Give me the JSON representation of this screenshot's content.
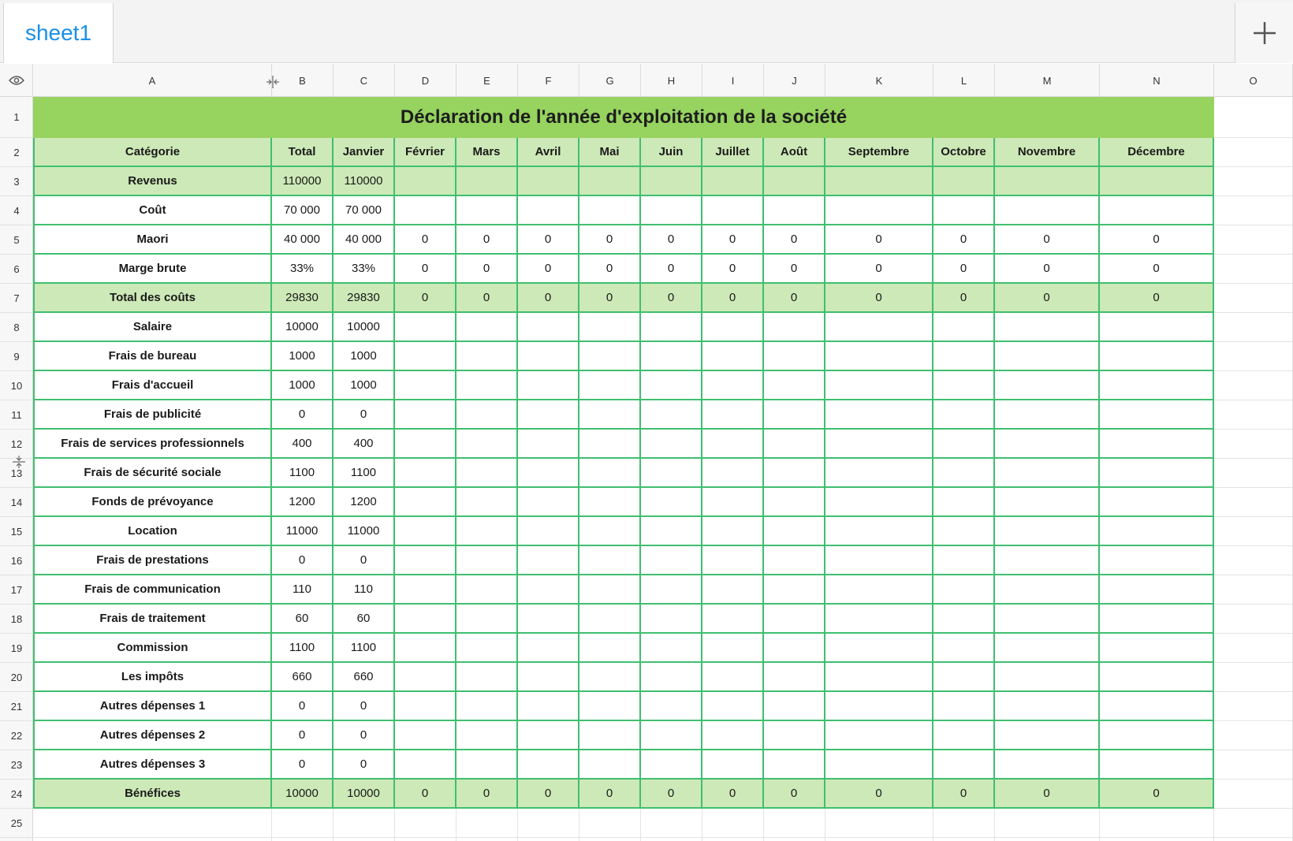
{
  "tabs": [
    {
      "label": "sheet1",
      "active": true
    }
  ],
  "columns": [
    "A",
    "B",
    "C",
    "D",
    "E",
    "F",
    "G",
    "H",
    "I",
    "J",
    "K",
    "L",
    "M",
    "N",
    "O"
  ],
  "title": "Déclaration de l'année d'exploitation de la société",
  "header_row": [
    "Catégorie",
    "Total",
    "Janvier",
    "Février",
    "Mars",
    "Avril",
    "Mai",
    "Juin",
    "Juillet",
    "Août",
    "Septembre",
    "Octobre",
    "Novembre",
    "Décembre"
  ],
  "rows": [
    {
      "n": 3,
      "style": "lg",
      "cells": [
        "Revenus",
        "110000",
        "110000",
        "",
        "",
        "",
        "",
        "",
        "",
        "",
        "",
        "",
        "",
        ""
      ]
    },
    {
      "n": 4,
      "style": "wh",
      "cells": [
        "Coût",
        "70 000",
        "70 000",
        "",
        "",
        "",
        "",
        "",
        "",
        "",
        "",
        "",
        "",
        ""
      ]
    },
    {
      "n": 5,
      "style": "wh",
      "cells": [
        "Maori",
        "40 000",
        "40 000",
        "0",
        "0",
        "0",
        "0",
        "0",
        "0",
        "0",
        "0",
        "0",
        "0",
        "0"
      ]
    },
    {
      "n": 6,
      "style": "wh",
      "cells": [
        "Marge brute",
        "33%",
        "33%",
        "0",
        "0",
        "0",
        "0",
        "0",
        "0",
        "0",
        "0",
        "0",
        "0",
        "0"
      ]
    },
    {
      "n": 7,
      "style": "lg",
      "cells": [
        "Total des coûts",
        "29830",
        "29830",
        "0",
        "0",
        "0",
        "0",
        "0",
        "0",
        "0",
        "0",
        "0",
        "0",
        "0"
      ]
    },
    {
      "n": 8,
      "style": "wh",
      "cells": [
        "Salaire",
        "10000",
        "10000",
        "",
        "",
        "",
        "",
        "",
        "",
        "",
        "",
        "",
        "",
        ""
      ]
    },
    {
      "n": 9,
      "style": "wh",
      "cells": [
        "Frais de bureau",
        "1000",
        "1000",
        "",
        "",
        "",
        "",
        "",
        "",
        "",
        "",
        "",
        "",
        ""
      ]
    },
    {
      "n": 10,
      "style": "wh",
      "cells": [
        "Frais d'accueil",
        "1000",
        "1000",
        "",
        "",
        "",
        "",
        "",
        "",
        "",
        "",
        "",
        "",
        ""
      ]
    },
    {
      "n": 11,
      "style": "wh",
      "cells": [
        "Frais de publicité",
        "0",
        "0",
        "",
        "",
        "",
        "",
        "",
        "",
        "",
        "",
        "",
        "",
        ""
      ]
    },
    {
      "n": 12,
      "style": "wh",
      "cells": [
        "Frais de services professionnels",
        "400",
        "400",
        "",
        "",
        "",
        "",
        "",
        "",
        "",
        "",
        "",
        "",
        ""
      ]
    },
    {
      "n": 13,
      "style": "wh",
      "cells": [
        "Frais de sécurité sociale",
        "1100",
        "1100",
        "",
        "",
        "",
        "",
        "",
        "",
        "",
        "",
        "",
        "",
        ""
      ]
    },
    {
      "n": 14,
      "style": "wh",
      "cells": [
        "Fonds de prévoyance",
        "1200",
        "1200",
        "",
        "",
        "",
        "",
        "",
        "",
        "",
        "",
        "",
        "",
        ""
      ]
    },
    {
      "n": 15,
      "style": "wh",
      "cells": [
        "Location",
        "11000",
        "11000",
        "",
        "",
        "",
        "",
        "",
        "",
        "",
        "",
        "",
        "",
        ""
      ]
    },
    {
      "n": 16,
      "style": "wh",
      "cells": [
        "Frais de prestations",
        "0",
        "0",
        "",
        "",
        "",
        "",
        "",
        "",
        "",
        "",
        "",
        "",
        ""
      ]
    },
    {
      "n": 17,
      "style": "wh",
      "cells": [
        "Frais de communication",
        "110",
        "110",
        "",
        "",
        "",
        "",
        "",
        "",
        "",
        "",
        "",
        "",
        ""
      ]
    },
    {
      "n": 18,
      "style": "wh",
      "cells": [
        "Frais de traitement",
        "60",
        "60",
        "",
        "",
        "",
        "",
        "",
        "",
        "",
        "",
        "",
        "",
        ""
      ]
    },
    {
      "n": 19,
      "style": "wh",
      "cells": [
        "Commission",
        "1100",
        "1100",
        "",
        "",
        "",
        "",
        "",
        "",
        "",
        "",
        "",
        "",
        ""
      ]
    },
    {
      "n": 20,
      "style": "wh",
      "cells": [
        "Les impôts",
        "660",
        "660",
        "",
        "",
        "",
        "",
        "",
        "",
        "",
        "",
        "",
        "",
        ""
      ]
    },
    {
      "n": 21,
      "style": "wh",
      "cells": [
        "Autres dépenses 1",
        "0",
        "0",
        "",
        "",
        "",
        "",
        "",
        "",
        "",
        "",
        "",
        "",
        ""
      ]
    },
    {
      "n": 22,
      "style": "wh",
      "cells": [
        "Autres dépenses 2",
        "0",
        "0",
        "",
        "",
        "",
        "",
        "",
        "",
        "",
        "",
        "",
        "",
        ""
      ]
    },
    {
      "n": 23,
      "style": "wh",
      "cells": [
        "Autres dépenses 3",
        "0",
        "0",
        "",
        "",
        "",
        "",
        "",
        "",
        "",
        "",
        "",
        "",
        ""
      ]
    },
    {
      "n": 24,
      "style": "lg",
      "cells": [
        "Bénéfices",
        "10000",
        "10000",
        "0",
        "0",
        "0",
        "0",
        "0",
        "0",
        "0",
        "0",
        "0",
        "0",
        "0"
      ]
    }
  ],
  "extra_row_numbers": [
    "1",
    "2",
    "25"
  ],
  "colors": {
    "title_fill": "#96d35f",
    "header_fill": "#cde9b7",
    "border": "#3fbf6f",
    "tab_text": "#1a90e6"
  },
  "icons": {
    "eye": "eye-icon",
    "add": "plus-icon",
    "resize": "column-resize-icon"
  }
}
